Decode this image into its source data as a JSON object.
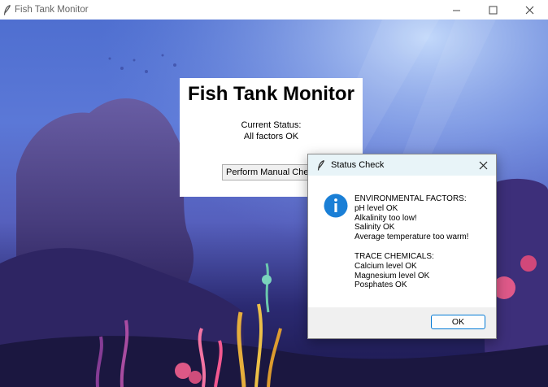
{
  "window": {
    "title": "Fish Tank Monitor",
    "controls": {
      "minimize": "—",
      "maximize": "☐",
      "close": "✕"
    }
  },
  "panel": {
    "heading": "Fish Tank Monitor",
    "status_caption": "Current Status:",
    "status_text": "All factors OK",
    "manual_check_button": "Perform Manual Che"
  },
  "dialog": {
    "title": "Status Check",
    "icon": "info-icon",
    "environmental": {
      "heading": "ENVIRONMENTAL FACTORS:",
      "items": [
        "pH level OK",
        "Alkalinity too low!",
        "Salinity OK",
        "Average temperature too warm!"
      ]
    },
    "trace": {
      "heading": "TRACE CHEMICALS:",
      "items": [
        "Calcium level OK",
        "Magnesium level OK",
        "Posphates OK"
      ]
    },
    "ok_button": "OK"
  },
  "colors": {
    "accent": "#0078d4",
    "info_icon": "#1a7fd6",
    "dialog_titlebar": "#e8f4f8",
    "scene_sky": "#5b78d7",
    "scene_deep": "#1c184c"
  }
}
